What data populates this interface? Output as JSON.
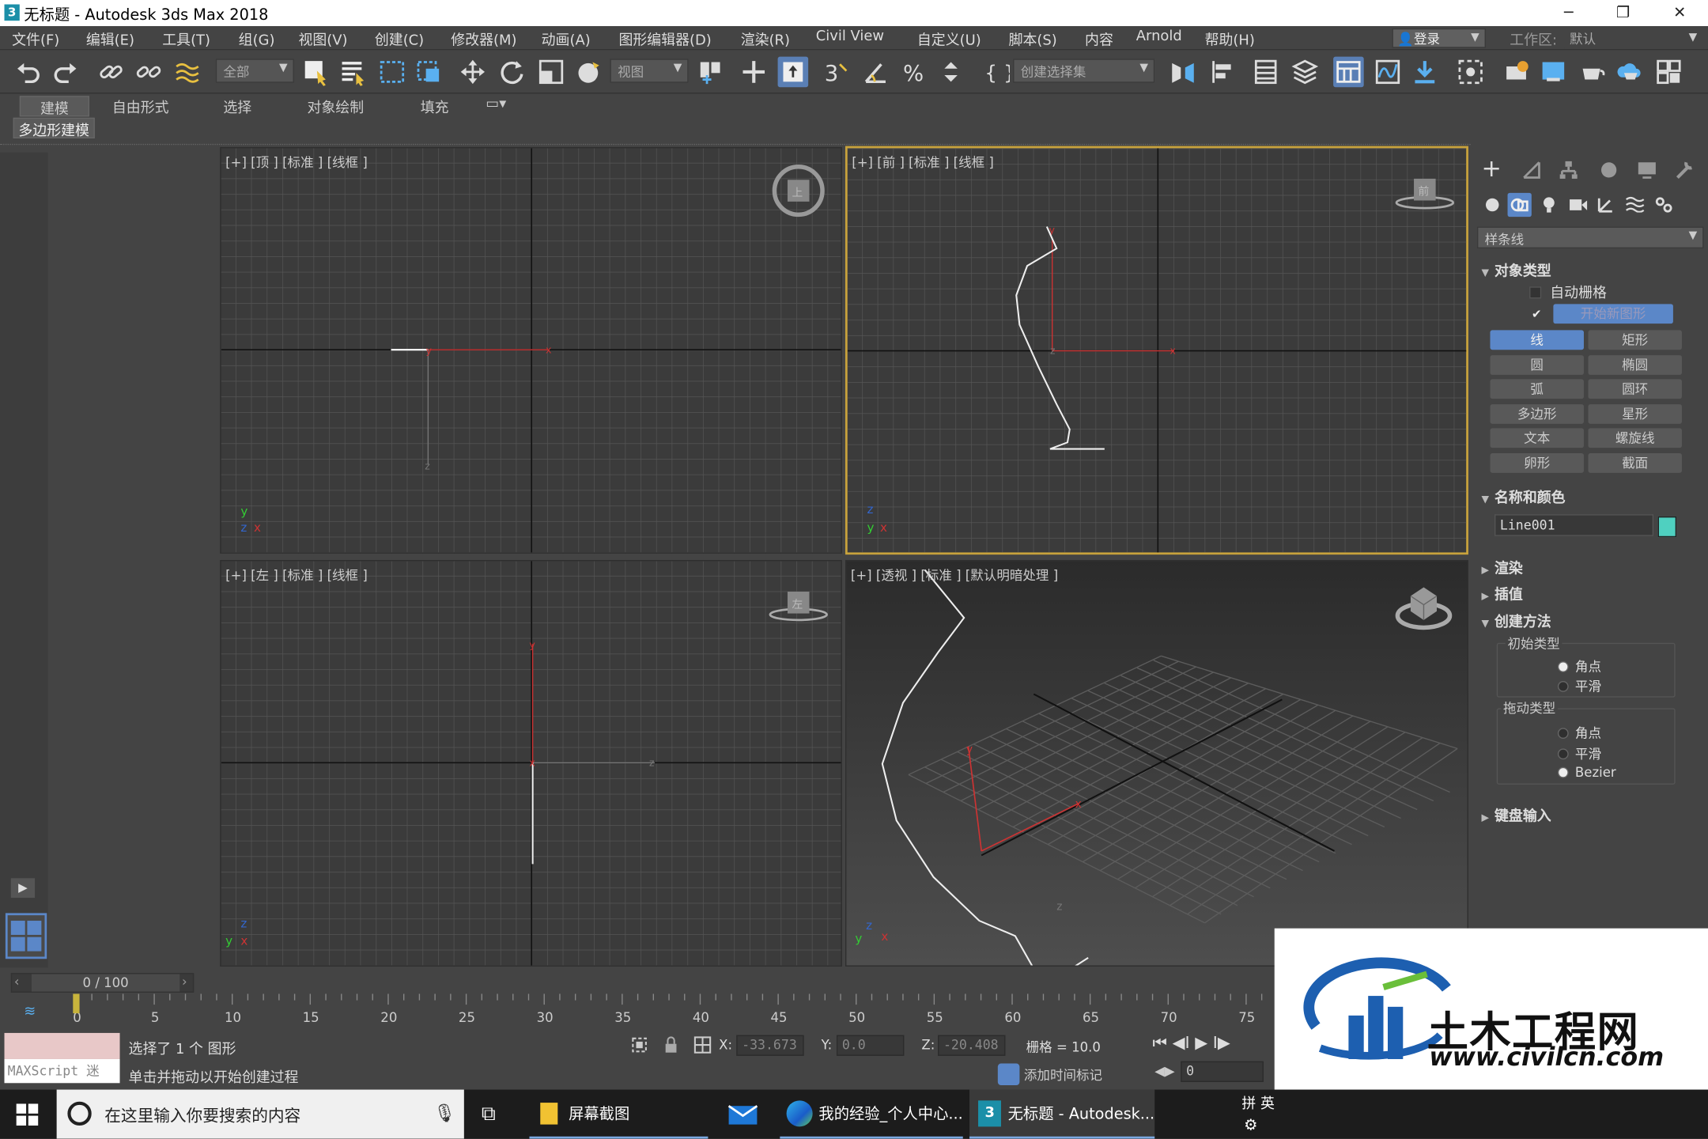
{
  "titlebar": {
    "title": "无标题 - Autodesk 3ds Max 2018",
    "logo": "3",
    "minimize": "─",
    "maximize": "❐",
    "close": "✕"
  },
  "menus": [
    "文件(F)",
    "编辑(E)",
    "工具(T)",
    "组(G)",
    "视图(V)",
    "创建(C)",
    "修改器(M)",
    "动画(A)",
    "图形编辑器(D)",
    "渲染(R)",
    "Civil View",
    "自定义(U)",
    "脚本(S)",
    "内容",
    "Arnold",
    "帮助(H)"
  ],
  "account": {
    "login": "登录",
    "workspace_label": "工作区:",
    "workspace_value": "默认"
  },
  "toolbar": {
    "filter_value": "全部",
    "refcoord_value": "视图",
    "selset_placeholder": "创建选择集"
  },
  "ribbon": {
    "tabs": [
      "建模",
      "自由形式",
      "选择",
      "对象绘制",
      "填充"
    ],
    "sub_tab": "多边形建模"
  },
  "viewports": {
    "top": "[+] [顶 ] [标准 ] [线框 ]",
    "front": "[+] [前 ] [标准 ] [线框 ]",
    "left": "[+] [左 ] [标准 ] [线框 ]",
    "persp": "[+] [透视 ] [标准 ] [默认明暗处理 ]",
    "viewcube_top": "上",
    "viewcube_front": "前",
    "viewcube_left": "左"
  },
  "command_panel": {
    "category_dropdown": "样条线",
    "rollout_object_type": "对象类型",
    "autogrid": "自动栅格",
    "start_new_shape": "开始新图形",
    "object_buttons": [
      "线",
      "矩形",
      "圆",
      "椭圆",
      "弧",
      "圆环",
      "多边形",
      "星形",
      "文本",
      "螺旋线",
      "卵形",
      "截面"
    ],
    "rollout_name_color": "名称和颜色",
    "object_name": "Line001",
    "object_color": "#4fd0c0",
    "rollout_render": "渲染",
    "rollout_interp": "插值",
    "rollout_creation": "创建方法",
    "initial_type": "初始类型",
    "initial_options": [
      "角点",
      "平滑"
    ],
    "drag_type": "拖动类型",
    "drag_options": [
      "角点",
      "平滑",
      "Bezier"
    ],
    "rollout_keyboard": "键盘输入"
  },
  "timeline": {
    "frame_display": "0 / 100",
    "ticks": [
      "0",
      "5",
      "10",
      "15",
      "20",
      "25",
      "30",
      "35",
      "40",
      "45",
      "50",
      "55",
      "60",
      "65",
      "70",
      "75"
    ]
  },
  "status": {
    "maxscript": "MAXScript 迷",
    "selected": "选择了 1 个 图形",
    "prompt": "单击并拖动以开始创建过程",
    "x_label": "X:",
    "x_value": "-33.673",
    "y_label": "Y:",
    "y_value": "0.0",
    "z_label": "Z:",
    "z_value": "-20.408",
    "grid": "栅格 = 10.0",
    "add_time_tag": "添加时间标记",
    "frame_input": "0"
  },
  "taskbar": {
    "search": "在这里输入你要搜索的内容",
    "items": [
      "屏幕截图",
      "我的经验_个人中心...",
      "无标题 - Autodesk..."
    ],
    "ime": "拼 英"
  },
  "watermark": {
    "brand": "土木工程网",
    "url": "www.civilcn.com"
  }
}
